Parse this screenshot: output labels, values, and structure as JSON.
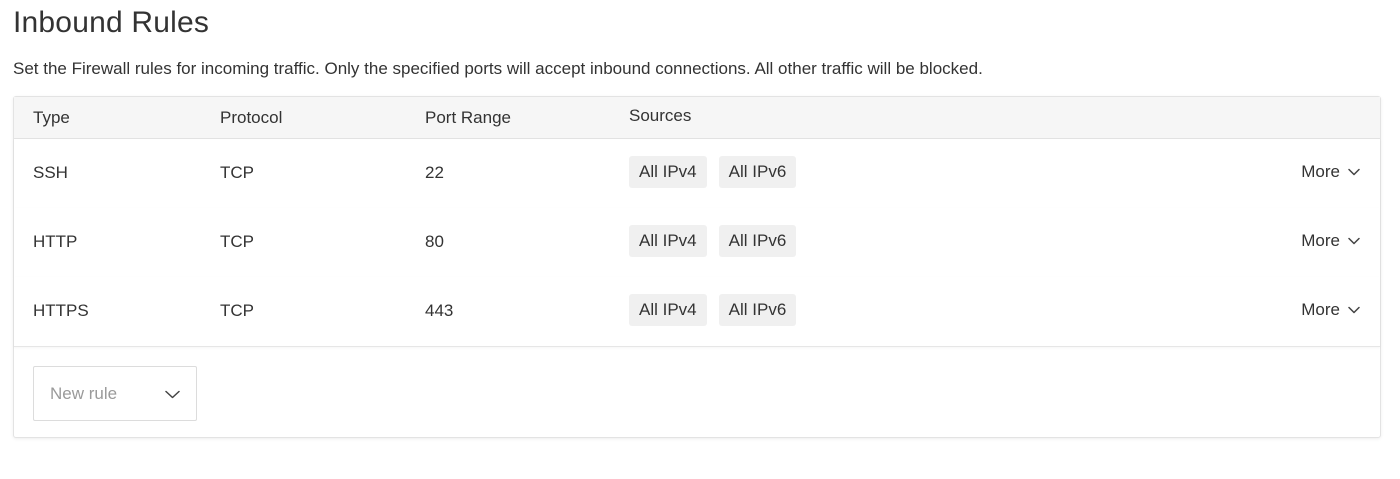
{
  "section": {
    "title": "Inbound Rules",
    "description": "Set the Firewall rules for incoming traffic. Only the specified ports will accept inbound connections. All other traffic will be blocked."
  },
  "table": {
    "columns": {
      "type": "Type",
      "protocol": "Protocol",
      "port_range": "Port Range",
      "sources": "Sources"
    },
    "rows": [
      {
        "type": "SSH",
        "protocol": "TCP",
        "port_range": "22",
        "sources": [
          "All IPv4",
          "All IPv6"
        ],
        "more_label": "More"
      },
      {
        "type": "HTTP",
        "protocol": "TCP",
        "port_range": "80",
        "sources": [
          "All IPv4",
          "All IPv6"
        ],
        "more_label": "More"
      },
      {
        "type": "HTTPS",
        "protocol": "TCP",
        "port_range": "443",
        "sources": [
          "All IPv4",
          "All IPv6"
        ],
        "more_label": "More"
      }
    ]
  },
  "new_rule": {
    "placeholder": "New rule",
    "icon": "chevron-down-icon"
  },
  "colors": {
    "text": "#333333",
    "header_bg": "#f6f6f6",
    "tag_bg": "#f0f0f0",
    "placeholder": "#9a9a9a",
    "border": "#e3e3e3"
  }
}
